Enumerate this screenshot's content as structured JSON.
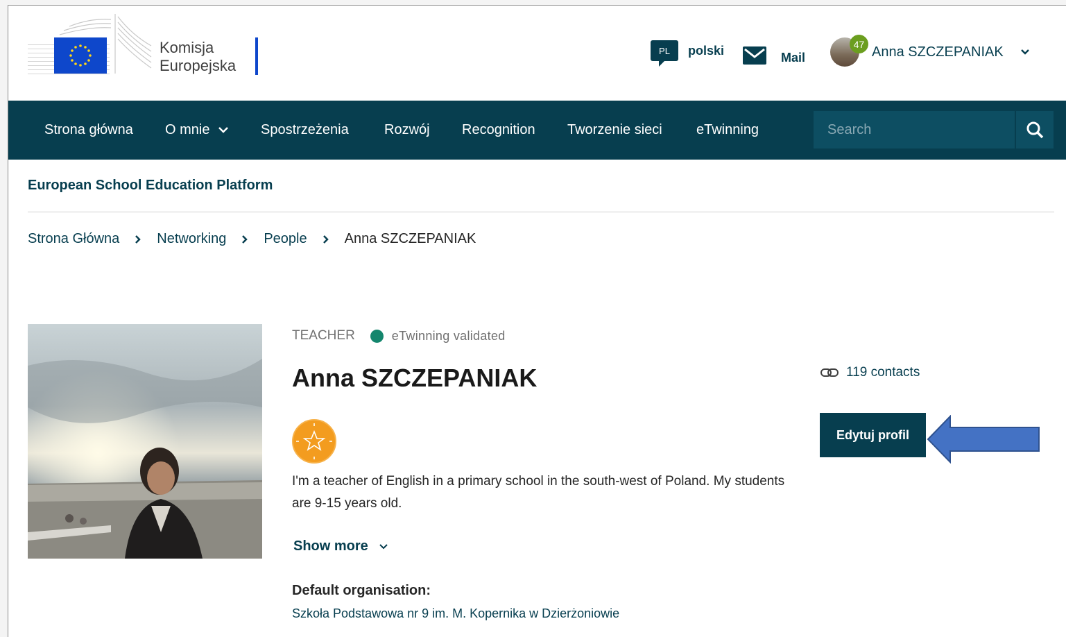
{
  "header": {
    "logo_text_line1": "Komisja",
    "logo_text_line2": "Europejska",
    "language_code": "PL",
    "language_label": "polski",
    "mail_label": "Mail",
    "user_name": "Anna SZCZEPANIAK",
    "notification_count": "47"
  },
  "nav": {
    "items": [
      {
        "label": "Strona główna"
      },
      {
        "label": "O mnie"
      },
      {
        "label": "Spostrzeżenia"
      },
      {
        "label": "Rozwój"
      },
      {
        "label": "Recognition"
      },
      {
        "label": "Tworzenie sieci"
      },
      {
        "label": "eTwinning"
      }
    ],
    "search_placeholder": "Search"
  },
  "site_title": "European School Education Platform",
  "breadcrumb": [
    "Strona Główna",
    "Networking",
    "People",
    "Anna SZCZEPANIAK"
  ],
  "profile": {
    "role": "TEACHER",
    "validation": "eTwinning validated",
    "name": "Anna SZCZEPANIAK",
    "bio": "I'm a teacher of English in a primary school in the south-west of Poland. My students are 9-15 years old.",
    "show_more": "Show more",
    "org_label": "Default organisation:",
    "org_value": "Szkoła Podstawowa nr 9 im. M. Kopernika w Dzierżoniowie",
    "contacts": "119 contacts",
    "edit_button": "Edytuj profil"
  },
  "colors": {
    "brand_dark": "#073e4f",
    "validated_green": "#14866d",
    "badge_orange": "#f39c1f",
    "arrow_blue": "#4472c4"
  },
  "icons": [
    "eu-flag-icon",
    "speech-bubble-icon",
    "mail-icon",
    "chevron-down-icon",
    "search-icon",
    "chevron-right-icon",
    "link-icon",
    "star-badge-icon",
    "arrow-left-icon"
  ]
}
